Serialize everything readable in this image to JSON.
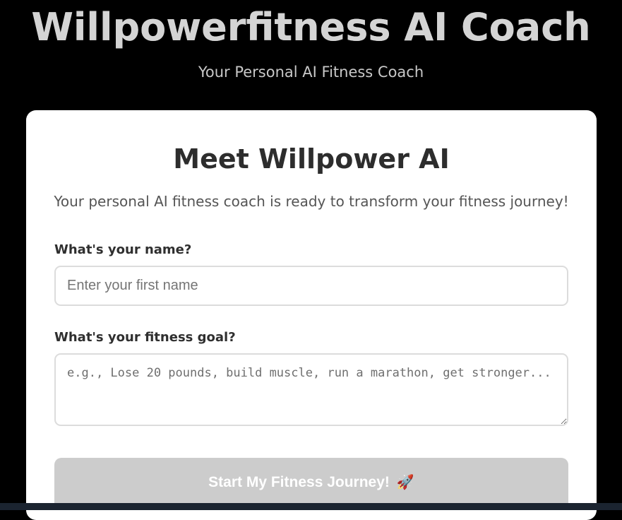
{
  "header": {
    "title": "Willpowerfitness AI Coach",
    "subtitle": "Your Personal AI Fitness Coach"
  },
  "card": {
    "title": "Meet Willpower AI",
    "description": "Your personal AI fitness coach is ready to transform your fitness journey!"
  },
  "form": {
    "name_label": "What's your name?",
    "name_value": "",
    "name_placeholder": "Enter your first name",
    "goal_label": "What's your fitness goal?",
    "goal_value": "",
    "goal_placeholder": "e.g., Lose 20 pounds, build muscle, run a marathon, get stronger...",
    "submit_label": "Start My Fitness Journey!",
    "submit_icon": "rocket-icon",
    "submit_icon_glyph": "🚀",
    "submit_disabled": true
  },
  "colors": {
    "page_background": "#000000",
    "card_background": "#ffffff",
    "button_disabled": "#cccccc",
    "heading_text": "#2d2d2d"
  }
}
